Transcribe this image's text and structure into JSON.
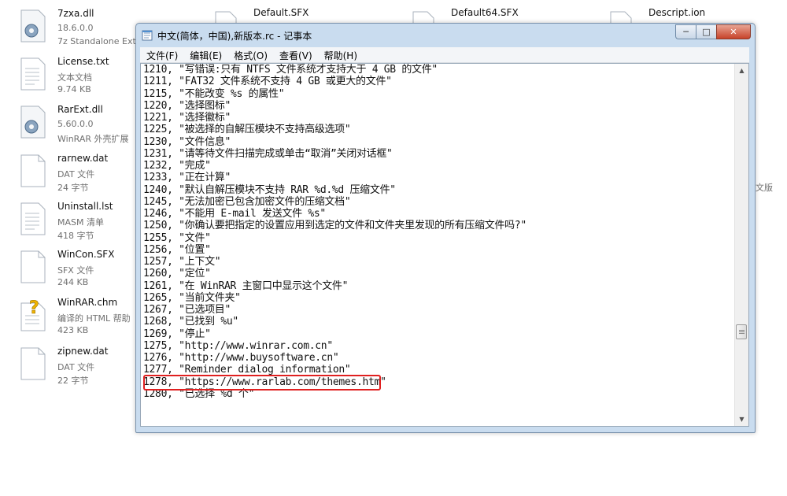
{
  "desktop_files": [
    {
      "name": "7zxa.dll",
      "type": "18.6.0.0",
      "size": "7z Standalone Ext",
      "icon": "gear-file-icon"
    },
    {
      "name": "License.txt",
      "type": "文本文档",
      "size": "9.74 KB",
      "icon": "text-file-icon"
    },
    {
      "name": "RarExt.dll",
      "type": "5.60.0.0",
      "size": "WinRAR 外壳扩展",
      "icon": "gear-file-icon"
    },
    {
      "name": "rarnew.dat",
      "type": "DAT 文件",
      "size": "24 字节",
      "icon": "blank-file-icon"
    },
    {
      "name": "Uninstall.lst",
      "type": "MASM 清单",
      "size": "418 字节",
      "icon": "text-file-icon"
    },
    {
      "name": "WinCon.SFX",
      "type": "SFX 文件",
      "size": "244 KB",
      "icon": "blank-file-icon"
    },
    {
      "name": "WinRAR.chm",
      "type": "编译的 HTML 帮助",
      "size": "423 KB",
      "icon": "help-file-icon"
    },
    {
      "name": "zipnew.dat",
      "type": "DAT 文件",
      "size": "22 字节",
      "icon": "blank-file-icon"
    }
  ],
  "top_files": [
    {
      "name": "Default.SFX"
    },
    {
      "name": "Default64.SFX"
    },
    {
      "name": "Descript.ion"
    }
  ],
  "stray_label": "文版",
  "window": {
    "title": "中文(简体，中国),新版本.rc - 记事本",
    "menu": [
      "文件(F)",
      "编辑(E)",
      "格式(O)",
      "查看(V)",
      "帮助(H)"
    ]
  },
  "lines": [
    "1210, \"写错误:只有 NTFS 文件系统才支持大于 4 GB 的文件\"",
    "1211, \"FAT32 文件系统不支持 4 GB 或更大的文件\"",
    "1215, \"不能改变 %s 的属性\"",
    "1220, \"选择图标\"",
    "1221, \"选择徽标\"",
    "1225, \"被选择的自解压模块不支持高级选项\"",
    "1230, \"文件信息\"",
    "1231, \"请等待文件扫描完成或单击“取消”关闭对话框\"",
    "1232, \"完成\"",
    "1233, \"正在计算\"",
    "1240, \"默认自解压模块不支持 RAR %d.%d 压缩文件\"",
    "1245, \"无法加密已包含加密文件的压缩文档\"",
    "1246, \"不能用 E-mail 发送文件 %s\"",
    "1250, \"你确认要把指定的设置应用到选定的文件和文件夹里发现的所有压缩文件吗?\"",
    "1255, \"文件\"",
    "1256, \"位置\"",
    "1257, \"上下文\"",
    "1260, \"定位\"",
    "1261, \"在 WinRAR 主窗口中显示这个文件\"",
    "1265, \"当前文件夹\"",
    "1267, \"已选项目\"",
    "1268, \"已找到 %u\"",
    "1269, \"停止\"",
    "1275, \"http://www.winrar.com.cn\"",
    "1276, \"http://www.buysoftware.cn\"",
    "1277, \"Reminder dialog information\"",
    "1278, \"https://www.rarlab.com/themes.htm\"",
    "1280, \"已选择 %d 个\""
  ],
  "scrollbar": {
    "position": 0.74
  },
  "highlight": {
    "line": "1277",
    "color": "#e02020"
  }
}
